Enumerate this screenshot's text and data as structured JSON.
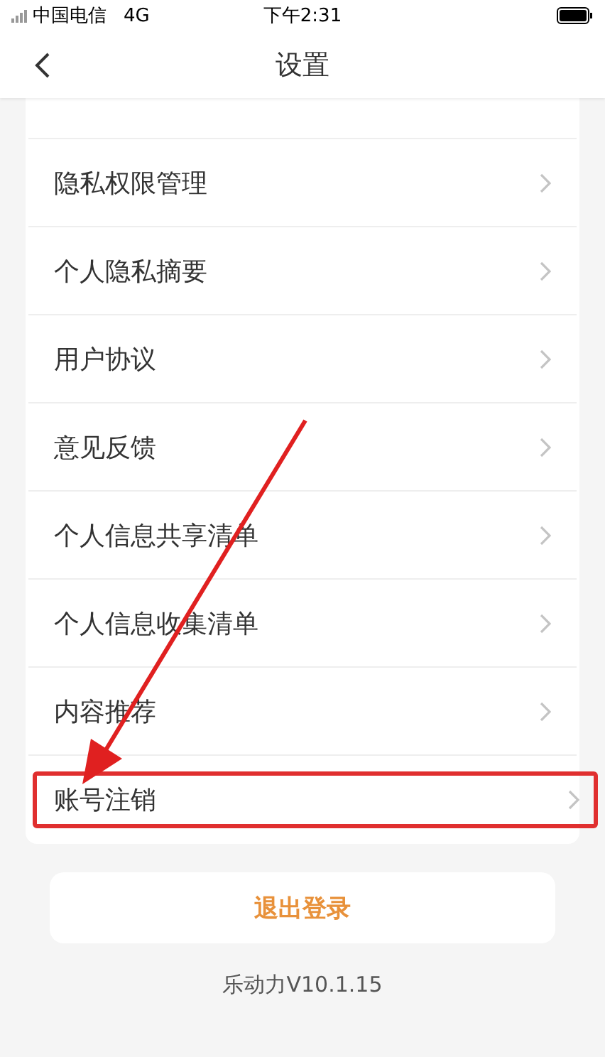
{
  "status_bar": {
    "carrier": "中国电信",
    "network": "4G",
    "time": "下午2:31"
  },
  "nav": {
    "title": "设置"
  },
  "items": [
    {
      "label": "隐私权限管理",
      "highlighted": false
    },
    {
      "label": "个人隐私摘要",
      "highlighted": false
    },
    {
      "label": "用户协议",
      "highlighted": false
    },
    {
      "label": "意见反馈",
      "highlighted": false
    },
    {
      "label": "个人信息共享清单",
      "highlighted": false
    },
    {
      "label": "个人信息收集清单",
      "highlighted": false
    },
    {
      "label": "内容推荐",
      "highlighted": false
    },
    {
      "label": "账号注销",
      "highlighted": true
    }
  ],
  "logout_button": "退出登录",
  "version": "乐动力V10.1.15"
}
